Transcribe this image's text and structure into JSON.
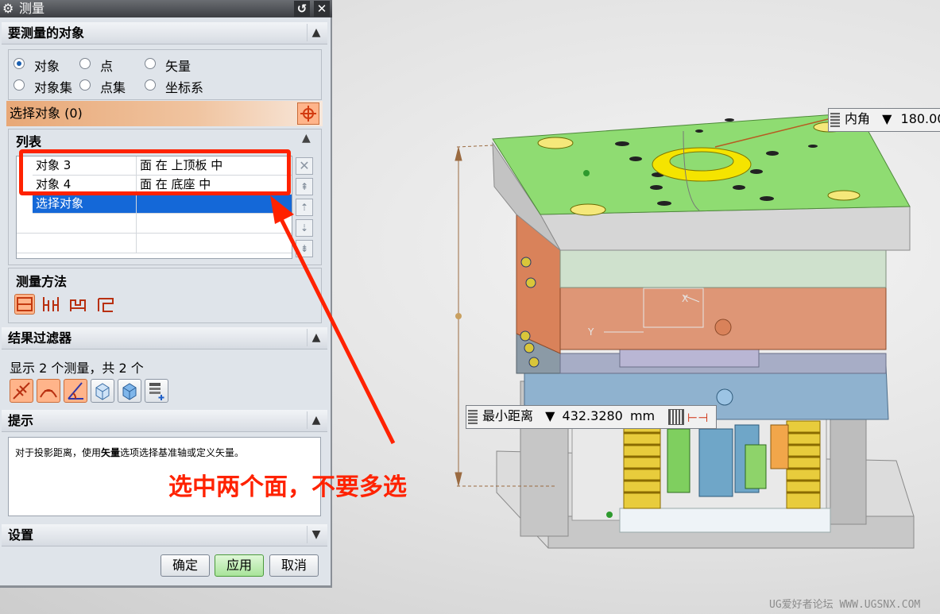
{
  "dialog": {
    "title": "测量",
    "sections": {
      "objects": "要测量的对象",
      "list": "列表",
      "method": "测量方法",
      "filter": "结果过滤器",
      "hint": "提示",
      "settings": "设置"
    },
    "radios": [
      {
        "label": "对象",
        "selected": true
      },
      {
        "label": "点",
        "selected": false
      },
      {
        "label": "矢量",
        "selected": false
      },
      {
        "label": "对象集",
        "selected": false
      },
      {
        "label": "点集",
        "selected": false
      },
      {
        "label": "坐标系",
        "selected": false
      }
    ],
    "select_bar": "选择对象 (0)",
    "list_rows": [
      {
        "name": "对象 3",
        "desc": "面 在 上顶板 中"
      },
      {
        "name": "对象 4",
        "desc": "面 在 底座 中"
      },
      {
        "name": "选择对象",
        "desc": ""
      }
    ],
    "filter_text": "显示 2 个测量，共 2 个",
    "hint_text_pre": "对于投影距离，使用",
    "hint_text_bold": "矢量",
    "hint_text_post": "选项选择基准轴或定义矢量。",
    "buttons": {
      "ok": "确定",
      "apply": "应用",
      "cancel": "取消"
    }
  },
  "annotation": "选中两个面，不要多选",
  "viewport": {
    "angle_flag": {
      "label": "内角",
      "value": "180.00"
    },
    "distance_flag": {
      "label": "最小距离",
      "value": "432.3280",
      "unit": "mm"
    },
    "axis_x": "X",
    "axis_y": "Y"
  },
  "watermark": "UG爱好者论坛 WWW.UGSNX.COM",
  "colors": {
    "highlight_red": "#ff2200",
    "select_blue": "#1468d8",
    "plate_green": "#8fdc72",
    "ring_yellow": "#f5e400"
  }
}
